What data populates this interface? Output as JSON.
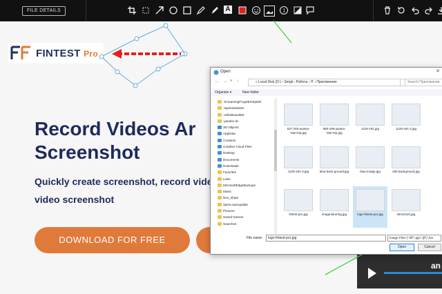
{
  "toolbar": {
    "file_details": "FILE DETAILS",
    "tools": [
      "crop-icon",
      "select-icon",
      "arrow-icon",
      "circle-icon",
      "rect-icon",
      "pen-icon",
      "marker-icon",
      "text-icon",
      "color-icon",
      "emoji-icon",
      "image-icon",
      "number-icon",
      "blur-icon",
      "comment-icon"
    ],
    "actions": [
      "delete-icon",
      "history-icon",
      "undo-icon",
      "redo-icon",
      "save-icon"
    ],
    "accent": "#e02020"
  },
  "page": {
    "logo": {
      "name": "FINTEST",
      "pro": "Pro"
    },
    "hero_title_1": "Record Videos Ar",
    "hero_title_2": "Screenshot",
    "hero_sub_1": "Quickly create screenshot, record vide",
    "hero_sub_2": "video screenshot",
    "download_label": "DOWNLOAD FOR FREE",
    "video_text": "an"
  },
  "dialog": {
    "title": "Open",
    "path": [
      "« Local Disk (D:)",
      "Sergii",
      "Работа",
      "IT",
      "Приложение"
    ],
    "search_placeholder": "Search Приложение",
    "organize": "Organize ▾",
    "new_folder": "New folder",
    "tree": [
      ".ScreamingFrogSEOSpider",
      ".spamassassin",
      ".websiteauditor",
      ".yandex-dc",
      "3D Objects",
      "AppData",
      "Contacts",
      "Creative Cloud Files",
      "Desktop",
      "Documents",
      "Downloads",
      "Favorites",
      "Links",
      "MicrosoftEdgeBackups",
      "Music",
      "Nox_share",
      "opera autoupdate",
      "Pictures",
      "Saved Games",
      "Searches"
    ],
    "files": [
      {
        "name": "537-240-шапка-твиттер.jpg",
        "sel": false
      },
      {
        "name": "580-196-шапка-твиттер.jpg",
        "sel": false
      },
      {
        "name": "1128-191.jpg",
        "sel": false
      },
      {
        "name": "1128-191-2.jpg",
        "sel": false
      },
      {
        "name": "1128-191-3.jpg",
        "sel": false
      },
      {
        "name": "blue-back-ground.jpg",
        "sel": false
      },
      {
        "name": "blue-image.jpg",
        "sel": false
      },
      {
        "name": "dsk-background.jpg",
        "sel": false
      },
      {
        "name": "fintest-pro.jpg",
        "sel": false
      },
      {
        "name": "image-blurring.jpg",
        "sel": false
      },
      {
        "name": "logo-fintest-pro.jpg",
        "sel": true
      },
      {
        "name": "skrinchort.jpg",
        "sel": false
      }
    ],
    "file_name_label": "File name:",
    "file_name_value": "logo-fintest-pro.jpg",
    "file_type": "Image Files (*.tiff;*.pjp;*.jfif;*.bm",
    "open_label": "Open",
    "cancel_label": "Cancel"
  }
}
